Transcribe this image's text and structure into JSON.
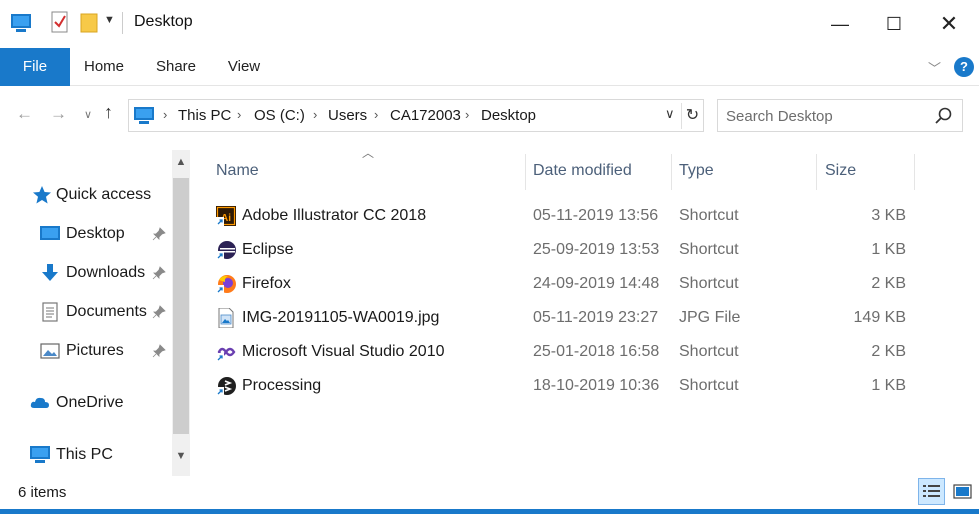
{
  "window": {
    "title": "Desktop",
    "minimize_glyph": "—",
    "maximize_glyph": "☐",
    "close_glyph": "✕"
  },
  "ribbon": {
    "tabs": [
      "File",
      "Home",
      "Share",
      "View"
    ],
    "help": "?"
  },
  "address": {
    "breadcrumbs": [
      "This PC",
      "OS (C:)",
      "Users",
      "CA172003",
      "Desktop"
    ]
  },
  "search": {
    "placeholder": "Search Desktop"
  },
  "nav_pane": {
    "quick_access": "Quick access",
    "items": [
      {
        "label": "Desktop",
        "icon": "desktop-icon",
        "pinned": true
      },
      {
        "label": "Downloads",
        "icon": "downloads-icon",
        "pinned": true
      },
      {
        "label": "Documents",
        "icon": "documents-icon",
        "pinned": true
      },
      {
        "label": "Pictures",
        "icon": "pictures-icon",
        "pinned": true
      }
    ],
    "onedrive": "OneDrive",
    "this_pc": "This PC"
  },
  "file_list": {
    "columns": [
      "Name",
      "Date modified",
      "Type",
      "Size"
    ],
    "rows": [
      {
        "name": "Adobe Illustrator CC 2018",
        "date": "05-11-2019 13:56",
        "type": "Shortcut",
        "size": "3 KB",
        "icon": "illustrator-icon"
      },
      {
        "name": "Eclipse",
        "date": "25-09-2019 13:53",
        "type": "Shortcut",
        "size": "1 KB",
        "icon": "eclipse-icon"
      },
      {
        "name": "Firefox",
        "date": "24-09-2019 14:48",
        "type": "Shortcut",
        "size": "2 KB",
        "icon": "firefox-icon"
      },
      {
        "name": "IMG-20191105-WA0019.jpg",
        "date": "05-11-2019 23:27",
        "type": "JPG File",
        "size": "149 KB",
        "icon": "image-file-icon"
      },
      {
        "name": "Microsoft Visual Studio 2010",
        "date": "25-01-2018 16:58",
        "type": "Shortcut",
        "size": "2 KB",
        "icon": "visual-studio-icon"
      },
      {
        "name": "Processing",
        "date": "18-10-2019 10:36",
        "type": "Shortcut",
        "size": "1 KB",
        "icon": "processing-icon"
      }
    ]
  },
  "status": {
    "item_count": "6 items"
  },
  "colors": {
    "accent": "#1979ca",
    "header_text": "#4c607a",
    "secondary_text": "#6d6d6d"
  }
}
